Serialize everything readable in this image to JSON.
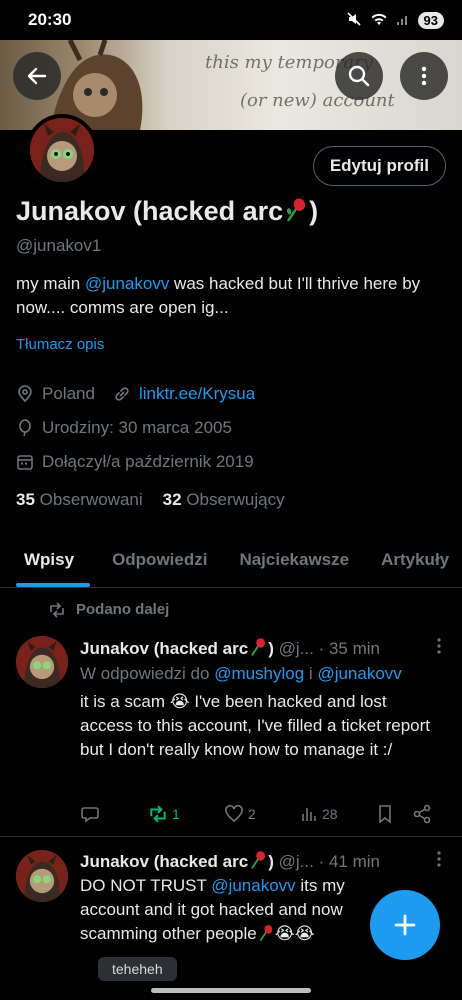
{
  "status_bar": {
    "time": "20:30",
    "battery": "93"
  },
  "banner": {
    "line1": "this my temporary",
    "line2": "(or new) account"
  },
  "profile": {
    "edit_label": "Edytuj profil",
    "name": "Junakov (hacked arc",
    "name_suffix": ")",
    "handle": "@junakov1",
    "bio_prefix": "my main ",
    "bio_mention": "@junakovv",
    "bio_rest": " was hacked but I'll thrive here by now.... comms are open ig...",
    "translate_label": "Tłumacz opis",
    "location": "Poland",
    "link": "linktr.ee/Krysua",
    "birthday": "Urodziny: 30 marca 2005",
    "joined": "Dołączył/a październik 2019",
    "following_count": "35",
    "following_label": "Obserwowani",
    "followers_count": "32",
    "followers_label": "Obserwujący"
  },
  "tabs": [
    {
      "label": "Wpisy"
    },
    {
      "label": "Odpowiedzi"
    },
    {
      "label": "Najciekawsze"
    },
    {
      "label": "Artykuły"
    }
  ],
  "tweets": [
    {
      "repost_label": "Podano dalej",
      "name": "Junakov (hacked arc",
      "name_suffix": ")",
      "handle": "@j...",
      "time": "· 35 min",
      "reply_prefix": "W odpowiedzi do ",
      "reply_mention1": "@mushylog",
      "reply_and": " i ",
      "reply_mention2": "@junakovv",
      "text": "it is a scam 😭 I've been hacked and lost access to this account, I've filled a ticket report but I don't really know how to manage it :/",
      "retweets": "1",
      "likes": "2",
      "views": "28"
    },
    {
      "name": "Junakov (hacked arc",
      "name_suffix": ")",
      "handle": "@j...",
      "time": "· 41 min",
      "text_prefix": "DO NOT TRUST ",
      "text_mention": "@junakovv",
      "text_rest": " its my account and it got hacked and now scamming other people",
      "emoji_end": "😭😭"
    }
  ],
  "toast": "teheheh",
  "colors": {
    "accent": "#1d9bf0",
    "retweet": "#00ba7c",
    "muted": "#71767b"
  }
}
